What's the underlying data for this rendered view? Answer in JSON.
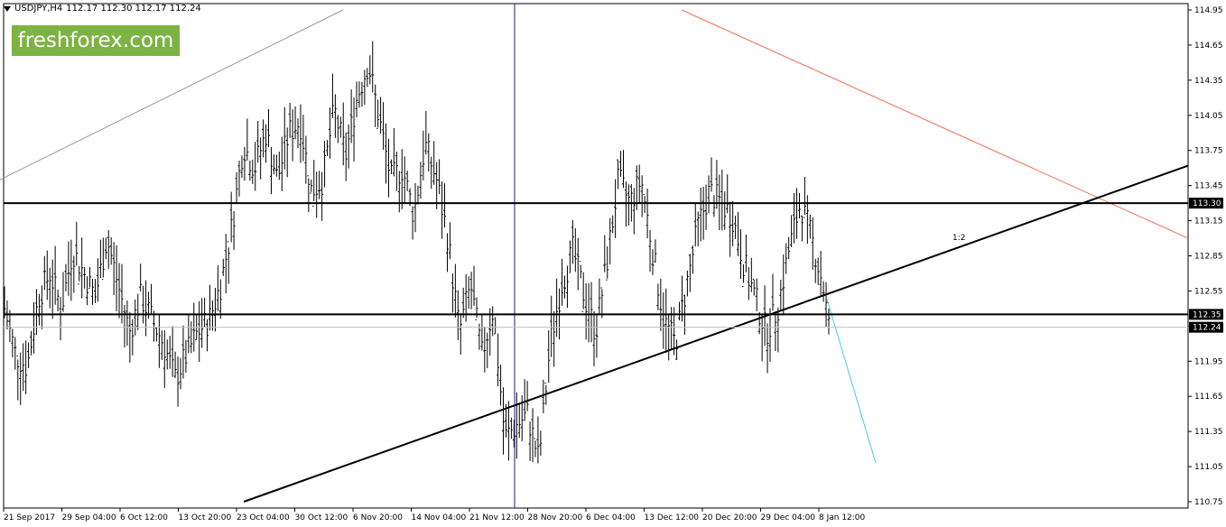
{
  "header": {
    "symbol": "USDJPY,H4",
    "ohlc": "112.17 112.30 112.17 112.24"
  },
  "logo": {
    "text": "freshforex.com"
  },
  "annotation": {
    "text": "1:2"
  },
  "colors": {
    "bars": "#000000",
    "resistance_trend": "#f26b4f",
    "projection": "#4fc8d8",
    "upper_trend": "#9a9a9a",
    "vline": "#1a237e",
    "price_line": "#c0c0c0"
  },
  "chart_data": {
    "type": "ohlc",
    "ylim": [
      10.75,
      114.95
    ],
    "y_ticks": [
      "114.95",
      "114.65",
      "114.35",
      "114.05",
      "113.75",
      "113.45",
      "113.15",
      "112.85",
      "112.55",
      "112.25",
      "111.95",
      "111.65",
      "111.35",
      "111.05",
      "110.75"
    ],
    "x_ticks": [
      "21 Sep 2017",
      "29 Sep 04:00",
      "6 Oct 12:00",
      "13 Oct 20:00",
      "23 Oct 04:00",
      "30 Oct 12:00",
      "6 Nov 20:00",
      "14 Nov 04:00",
      "21 Nov 12:00",
      "28 Nov 20:00",
      "6 Dec 04:00",
      "13 Dec 12:00",
      "20 Dec 20:00",
      "29 Dec 04:00",
      "8 Jan 12:00"
    ],
    "price_labels": [
      {
        "text": "113.30",
        "value": 113.3,
        "line": true
      },
      {
        "text": "112.35",
        "value": 112.35,
        "line": true
      },
      {
        "text": "112.24",
        "value": 112.24,
        "line": false
      }
    ],
    "close_path": [
      [
        0,
        112.4
      ],
      [
        2,
        112.0
      ],
      [
        4,
        111.9
      ],
      [
        6,
        112.5
      ],
      [
        8,
        112.7
      ],
      [
        10,
        112.4
      ],
      [
        12,
        112.9
      ],
      [
        14,
        112.7
      ],
      [
        16,
        112.5
      ],
      [
        18,
        113.0
      ],
      [
        20,
        112.6
      ],
      [
        22,
        112.2
      ],
      [
        24,
        112.5
      ],
      [
        26,
        112.3
      ],
      [
        28,
        112.1
      ],
      [
        30,
        111.8
      ],
      [
        32,
        112.0
      ],
      [
        34,
        112.2
      ],
      [
        36,
        112.3
      ],
      [
        38,
        112.6
      ],
      [
        40,
        113.1
      ],
      [
        42,
        113.8
      ],
      [
        44,
        113.6
      ],
      [
        46,
        113.9
      ],
      [
        48,
        113.5
      ],
      [
        50,
        113.9
      ],
      [
        52,
        114.0
      ],
      [
        54,
        113.4
      ],
      [
        56,
        113.5
      ],
      [
        58,
        114.1
      ],
      [
        60,
        113.7
      ],
      [
        62,
        114.2
      ],
      [
        64,
        114.5
      ],
      [
        66,
        114.0
      ],
      [
        68,
        113.5
      ],
      [
        70,
        113.6
      ],
      [
        72,
        113.2
      ],
      [
        74,
        113.8
      ],
      [
        76,
        113.5
      ],
      [
        78,
        113.0
      ],
      [
        80,
        112.2
      ],
      [
        82,
        112.6
      ],
      [
        84,
        112.0
      ],
      [
        86,
        112.4
      ],
      [
        88,
        111.3
      ],
      [
        90,
        111.4
      ],
      [
        92,
        111.5
      ],
      [
        94,
        111.1
      ],
      [
        96,
        112.1
      ],
      [
        98,
        112.6
      ],
      [
        100,
        112.9
      ],
      [
        102,
        112.5
      ],
      [
        104,
        112.2
      ],
      [
        106,
        112.8
      ],
      [
        108,
        113.5
      ],
      [
        110,
        113.3
      ],
      [
        112,
        113.5
      ],
      [
        114,
        112.9
      ],
      [
        116,
        112.3
      ],
      [
        118,
        112.1
      ],
      [
        120,
        112.6
      ],
      [
        122,
        113.1
      ],
      [
        124,
        113.4
      ],
      [
        126,
        113.3
      ],
      [
        128,
        113.2
      ],
      [
        130,
        112.8
      ],
      [
        132,
        112.5
      ],
      [
        134,
        112.2
      ],
      [
        136,
        112.4
      ],
      [
        138,
        112.9
      ],
      [
        140,
        113.3
      ],
      [
        142,
        113.0
      ],
      [
        144,
        112.6
      ],
      [
        145,
        112.24
      ]
    ],
    "lines": [
      {
        "name": "",
        "points": [
          [
            0,
            113.5
          ],
          [
            380,
            114.95
          ]
        ],
        "color": "upper_trend",
        "width": 1
      },
      {
        "name": "",
        "points": [
          [
            755,
            114.95
          ],
          [
            1316,
            113.0
          ]
        ],
        "color": "resistance_trend",
        "width": 1
      },
      {
        "name": "",
        "points": [
          [
            270,
            110.75
          ],
          [
            1316,
            113.62
          ]
        ],
        "color": "bars",
        "width": 2
      },
      {
        "name": "",
        "points": [
          [
            916,
            112.48
          ],
          [
            970,
            111.08
          ]
        ],
        "color": "projection",
        "width": 1
      }
    ],
    "vline_x": 570
  }
}
